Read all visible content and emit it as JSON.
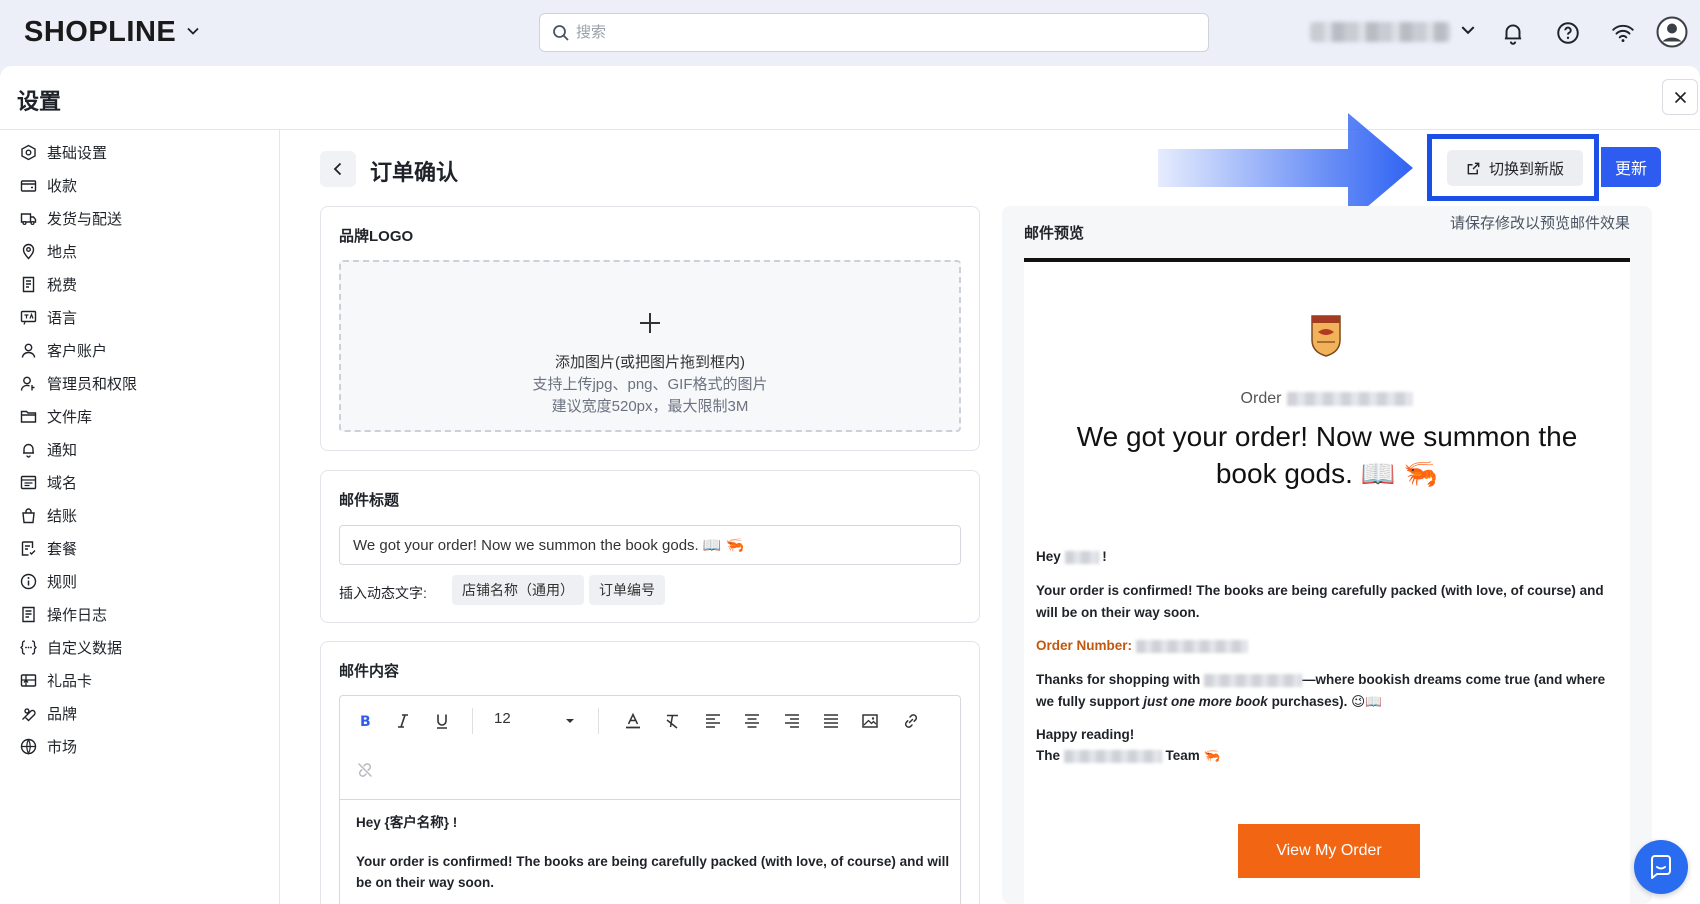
{
  "topbar": {
    "logo": "SHOPLINE",
    "search_placeholder": "搜索"
  },
  "panel": {
    "title": "设置"
  },
  "sidebar": {
    "items": [
      {
        "label": "基础设置",
        "icon": "hexagon-gear-icon"
      },
      {
        "label": "收款",
        "icon": "wallet-icon"
      },
      {
        "label": "发货与配送",
        "icon": "truck-icon"
      },
      {
        "label": "地点",
        "icon": "location-pin-icon"
      },
      {
        "label": "税费",
        "icon": "receipt-icon"
      },
      {
        "label": "语言",
        "icon": "language-icon"
      },
      {
        "label": "客户账户",
        "icon": "user-icon"
      },
      {
        "label": "管理员和权限",
        "icon": "user-key-icon"
      },
      {
        "label": "文件库",
        "icon": "folder-icon"
      },
      {
        "label": "通知",
        "icon": "bell-icon"
      },
      {
        "label": "域名",
        "icon": "browser-icon"
      },
      {
        "label": "结账",
        "icon": "bag-icon"
      },
      {
        "label": "套餐",
        "icon": "plan-icon"
      },
      {
        "label": "规则",
        "icon": "info-circle-icon"
      },
      {
        "label": "操作日志",
        "icon": "log-icon"
      },
      {
        "label": "自定义数据",
        "icon": "braces-icon"
      },
      {
        "label": "礼品卡",
        "icon": "gift-card-icon"
      },
      {
        "label": "品牌",
        "icon": "brand-icon"
      },
      {
        "label": "市场",
        "icon": "globe-icon"
      }
    ]
  },
  "header": {
    "page_title": "订单确认",
    "switch_label": "切换到新版",
    "update_label": "更新"
  },
  "logo_card": {
    "label": "品牌LOGO",
    "upload_line1": "添加图片(或把图片拖到框内)",
    "upload_line2": "支持上传jpg、png、GIF格式的图片",
    "upload_line3": "建议宽度520px，最大限制3M"
  },
  "subject_card": {
    "label": "邮件标题",
    "value": "We got your order! Now we summon the book gods. 📖 🦐",
    "insert_label": "插入动态文字:",
    "tags": [
      "店铺名称（通用）",
      "订单编号"
    ]
  },
  "content_card": {
    "label": "邮件内容",
    "font_size": "12",
    "body_line1": "Hey {客户名称} !",
    "body_line2": "Your order is confirmed! The books are being carefully packed (with love, of course) and will be on their way soon."
  },
  "preview": {
    "label": "邮件预览",
    "hint": "请保存修改以预览邮件效果",
    "order_prefix": "Order",
    "heading": "We got your order! Now we summon the book gods. 📖 🦐",
    "hey": "Hey",
    "hey_end": "!",
    "confirmed": "Your order is confirmed! The books are being carefully packed (with love, of course) and will be on their way soon.",
    "order_number": "Order Number:",
    "thanks_start": "Thanks for shopping with",
    "thanks_mid": "—where bookish dreams come true (and where we fully support",
    "thanks_em": "just one more book",
    "thanks_end": "purchases). 😉📖",
    "happy": "Happy reading!",
    "the": "The",
    "team": "Team 🦐",
    "cta": "View My Order"
  },
  "colors": {
    "primary": "#2f5cf0",
    "highlight_border": "#1b4fe6",
    "cta": "#f26512",
    "order_number": "#c2570d"
  }
}
